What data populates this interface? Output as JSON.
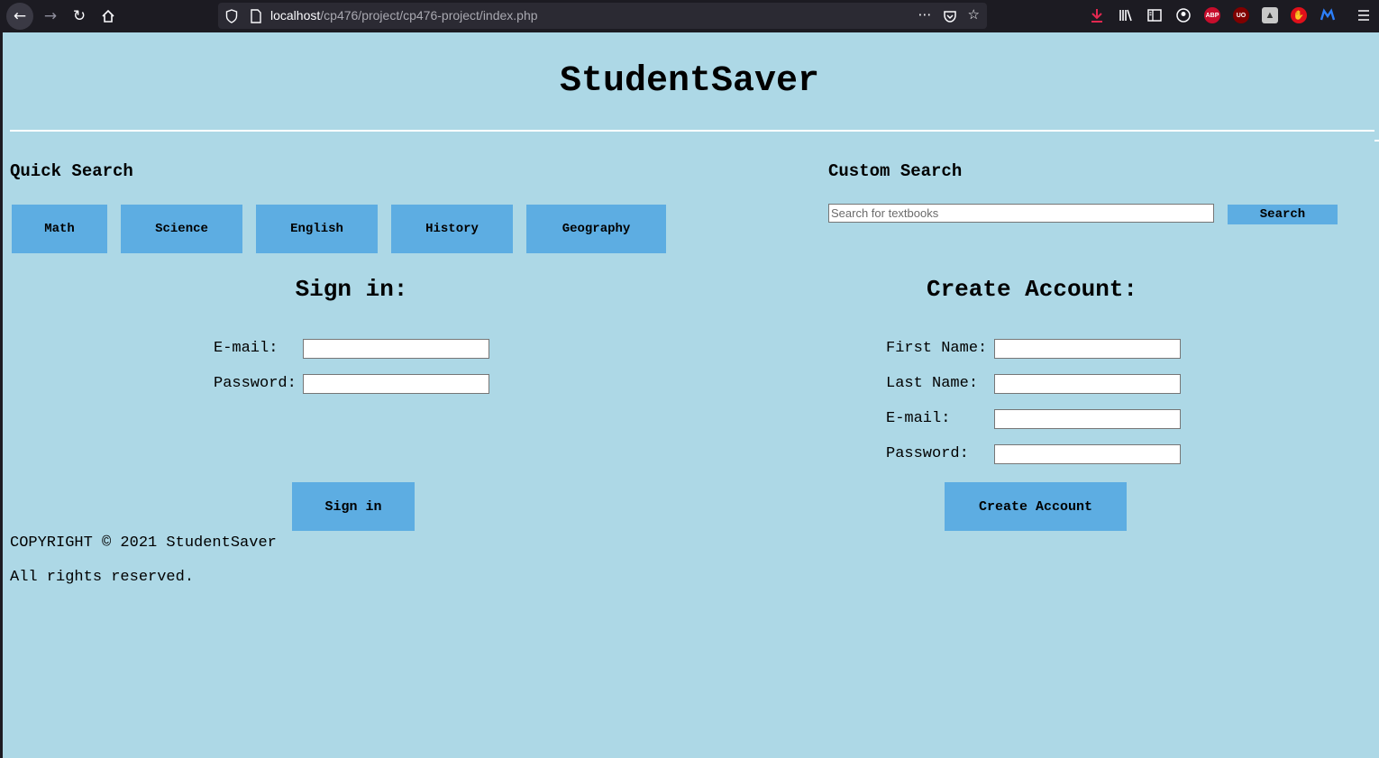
{
  "browser": {
    "url_host": "localhost",
    "url_path": "/cp476/project/cp476-project/index.php",
    "back_icon": "arrow-left-icon",
    "forward_icon": "arrow-right-icon",
    "reload_icon": "reload-icon",
    "home_icon": "home-icon",
    "extensions": [
      "ABP",
      "UO"
    ]
  },
  "header": {
    "title": "StudentSaver"
  },
  "quick_search": {
    "heading": "Quick Search",
    "buttons": [
      "Math",
      "Science",
      "English",
      "History",
      "Geography"
    ]
  },
  "custom_search": {
    "heading": "Custom Search",
    "placeholder": "Search for textbooks",
    "button_label": "Search"
  },
  "sign_in": {
    "title": "Sign in:",
    "email_label": "E-mail:",
    "password_label": "Password:",
    "button_label": "Sign in"
  },
  "create_account": {
    "title": "Create Account:",
    "first_name_label": "First Name:",
    "last_name_label": "Last Name:",
    "email_label": "E-mail:",
    "password_label": "Password:",
    "button_label": "Create Account"
  },
  "footer": {
    "copyright": "COPYRIGHT © 2021 StudentSaver",
    "rights": "All rights reserved."
  },
  "colors": {
    "page_background": "#add8e6",
    "button": "#5dade2",
    "chrome": "#1c1b22"
  }
}
